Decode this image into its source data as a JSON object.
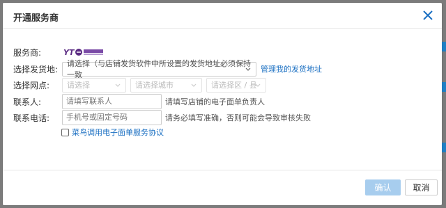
{
  "dialog": {
    "title": "开通服务商",
    "close_icon": "close-icon"
  },
  "form": {
    "provider": {
      "label": "服务商:",
      "logo_icon": "yto-express-logo"
    },
    "address": {
      "label": "选择发货地:",
      "select_value": "请选择（与店铺发货软件中所设置的发货地址必须保持一致",
      "manage_link": "管理我的发货地址"
    },
    "outlet": {
      "label": "选择网点:",
      "province_placeholder": "请选择",
      "city_placeholder": "请选择城市",
      "district_placeholder": "请选择区 / 县"
    },
    "contact": {
      "label": "联系人:",
      "placeholder": "请填写联系人",
      "hint": "请填写店铺的电子面单负责人"
    },
    "phone": {
      "label": "联系电话:",
      "placeholder": "手机号或固定号码",
      "hint": "请务必填写准确，否则可能会导致审核失败"
    },
    "agreement": {
      "label": "菜鸟调用电子面单服务协议",
      "checked": false
    }
  },
  "footer": {
    "confirm_label": "确认",
    "cancel_label": "取消"
  },
  "colors": {
    "link": "#1a6fc2",
    "confirm_disabled": "#a7cdee",
    "overlay": "#7b7b7b"
  }
}
